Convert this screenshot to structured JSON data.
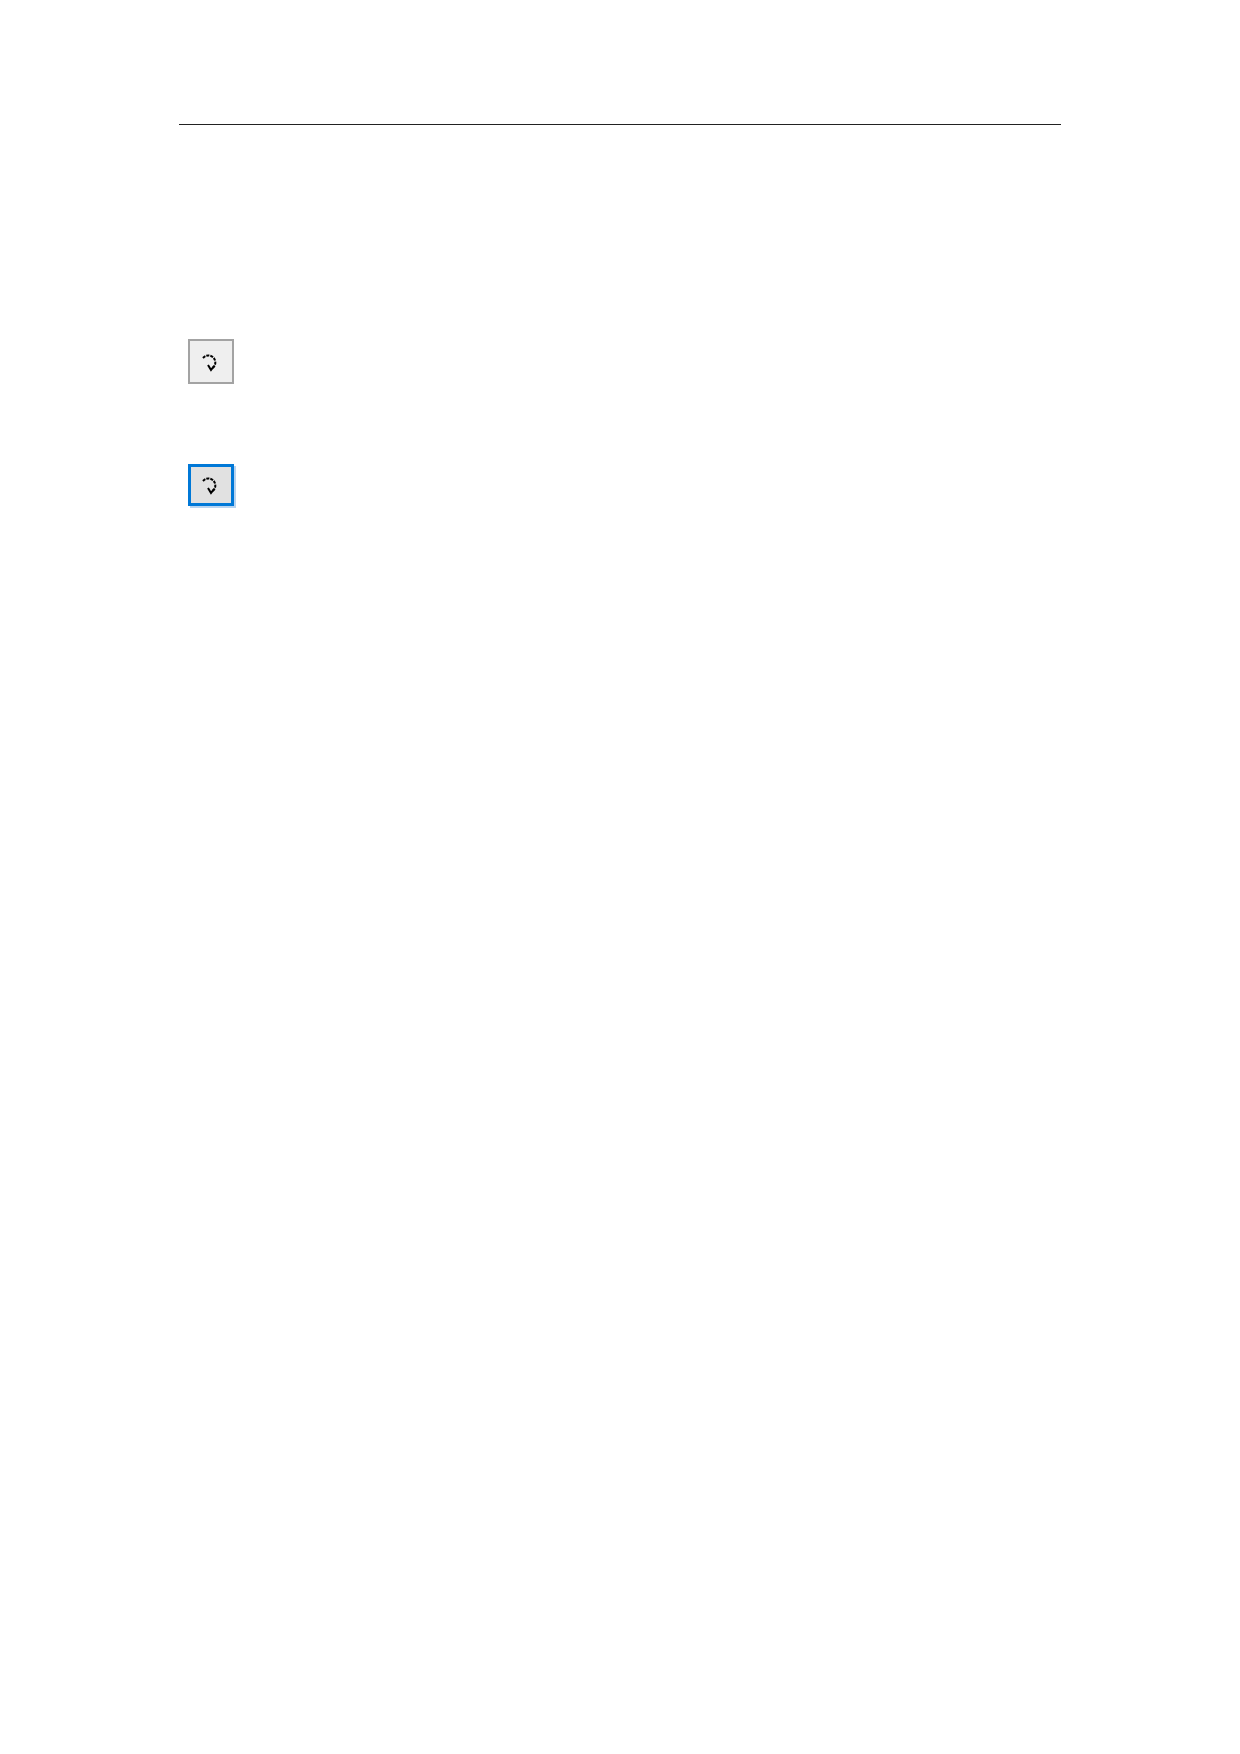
{
  "buttons": [
    {
      "highlighted": false
    },
    {
      "highlighted": true
    }
  ]
}
